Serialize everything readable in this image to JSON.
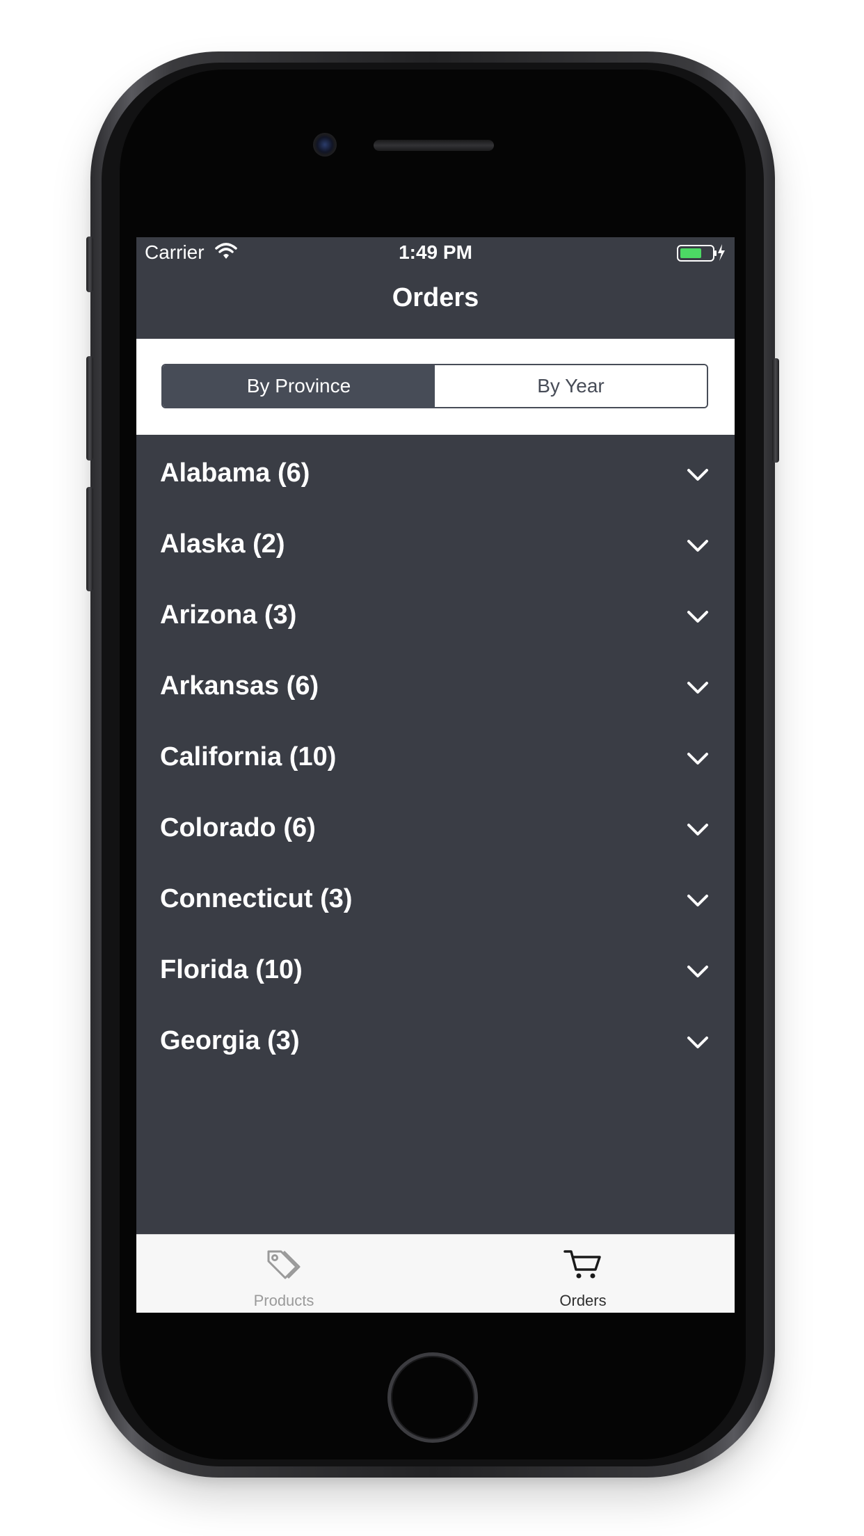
{
  "status_bar": {
    "carrier": "Carrier",
    "time": "1:49 PM",
    "battery_color": "#4cd964"
  },
  "nav": {
    "title": "Orders"
  },
  "segments": {
    "active": "By Province",
    "items": [
      "By Province",
      "By Year"
    ]
  },
  "provinces": [
    {
      "label": "Alabama (6)"
    },
    {
      "label": "Alaska (2)"
    },
    {
      "label": "Arizona (3)"
    },
    {
      "label": "Arkansas (6)"
    },
    {
      "label": "California (10)"
    },
    {
      "label": "Colorado (6)"
    },
    {
      "label": "Connecticut (3)"
    },
    {
      "label": "Florida (10)"
    },
    {
      "label": "Georgia (3)"
    }
  ],
  "tab_bar": {
    "items": [
      {
        "label": "Products",
        "icon": "price-tags-icon",
        "selected": false
      },
      {
        "label": "Orders",
        "icon": "shopping-cart-icon",
        "selected": true
      }
    ]
  },
  "colors": {
    "list_background": "#3a3d45",
    "segment_active": "#474c57"
  }
}
